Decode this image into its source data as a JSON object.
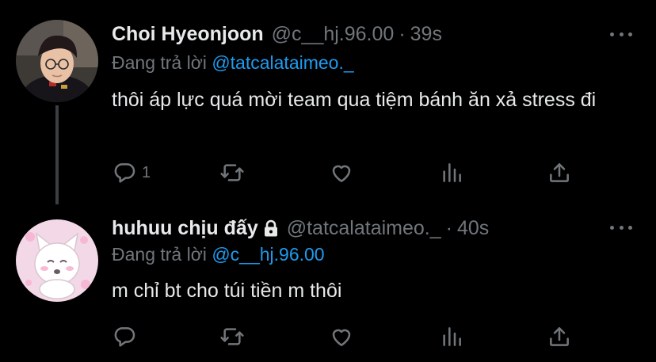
{
  "tweets": [
    {
      "name": "Choi Hyeonjoon",
      "handle": "@c__hj.96.00",
      "time": "39s",
      "replying_prefix": "Đang trả lời ",
      "replying_to": "@tatcalataimeo._",
      "text": "thôi áp lực quá mời team qua tiệm bánh ăn xả stress đi",
      "reply_count": "1",
      "locked": false
    },
    {
      "name": "huhuu chịu đấy",
      "handle": "@tatcalataimeo._",
      "time": "40s",
      "replying_prefix": "Đang trả lời ",
      "replying_to": "@c__hj.96.00",
      "text": "m chỉ bt cho túi tiền m thôi",
      "reply_count": "",
      "locked": true
    }
  ],
  "icons": [
    "reply-icon",
    "retweet-icon",
    "like-icon",
    "views-icon",
    "share-icon",
    "more-icon",
    "lock-icon"
  ],
  "colors": {
    "background": "#000000",
    "text": "#e7e9ea",
    "muted": "#71767b",
    "link": "#1d9bf0"
  }
}
